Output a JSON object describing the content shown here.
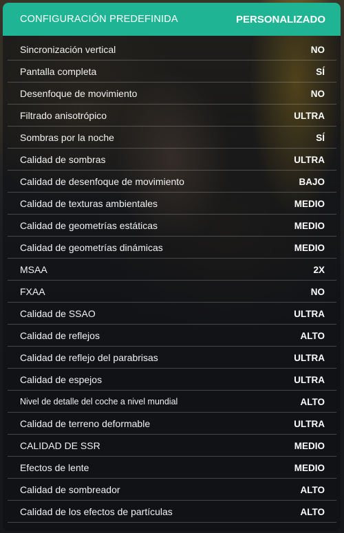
{
  "header": {
    "label": "CONFIGURACIÓN PREDEFINIDA",
    "value": "PERSONALIZADO",
    "accent_color": "#1fb493"
  },
  "settings": [
    {
      "label": "Sincronización vertical",
      "value": "NO"
    },
    {
      "label": "Pantalla completa",
      "value": "SÍ"
    },
    {
      "label": "Desenfoque de movimiento",
      "value": "NO"
    },
    {
      "label": "Filtrado anisotrópico",
      "value": "ULTRA"
    },
    {
      "label": "Sombras por la noche",
      "value": "SÍ"
    },
    {
      "label": "Calidad de sombras",
      "value": "ULTRA"
    },
    {
      "label": "Calidad de desenfoque de movimiento",
      "value": "BAJO"
    },
    {
      "label": "Calidad de texturas ambientales",
      "value": "MEDIO"
    },
    {
      "label": "Calidad de geometrías estáticas",
      "value": "MEDIO"
    },
    {
      "label": "Calidad de geometrías dinámicas",
      "value": "MEDIO"
    },
    {
      "label": "MSAA",
      "value": "2X"
    },
    {
      "label": "FXAA",
      "value": "NO"
    },
    {
      "label": "Calidad de SSAO",
      "value": "ULTRA"
    },
    {
      "label": "Calidad de reflejos",
      "value": "ALTO"
    },
    {
      "label": "Calidad de reflejo del parabrisas",
      "value": "ULTRA"
    },
    {
      "label": "Calidad de espejos",
      "value": "ULTRA"
    },
    {
      "label": "Nivel de detalle del coche a nivel mundial",
      "value": "ALTO"
    },
    {
      "label": "Calidad de terreno deformable",
      "value": "ULTRA"
    },
    {
      "label": "CALIDAD DE SSR",
      "value": "MEDIO"
    },
    {
      "label": "Efectos de lente",
      "value": "MEDIO"
    },
    {
      "label": "Calidad de sombreador",
      "value": "ALTO"
    },
    {
      "label": "Calidad de los efectos de partículas",
      "value": "ALTO"
    }
  ]
}
